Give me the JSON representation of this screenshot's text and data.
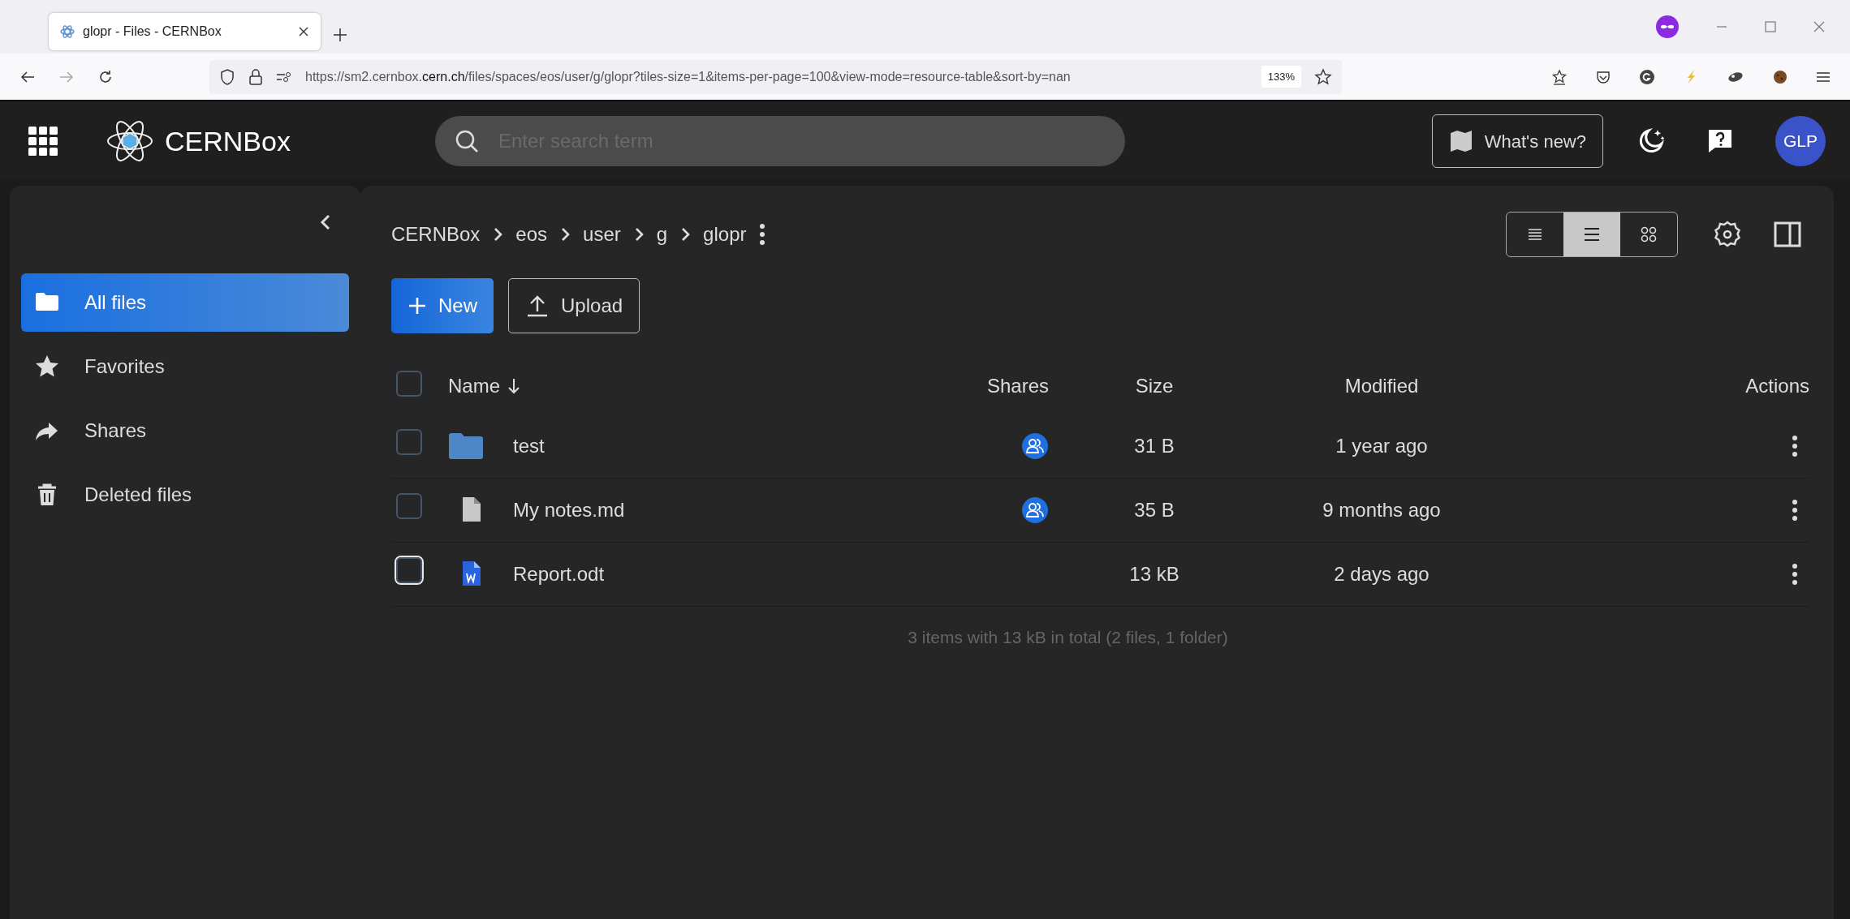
{
  "browser": {
    "tabs": [
      {
        "title": "glopr - Files - CERNBox",
        "selected": true
      }
    ],
    "url": "https://sm2.cernbox.**cern.ch**/files/spaces/eos/user/g/glopr?tiles-size=1&items-per-page=100&view-mode=resource-table&sort-by=nan",
    "zoom": "133%"
  },
  "header": {
    "logo": "CERNBox",
    "search": {
      "placeholder": "Enter search term"
    },
    "whats_new": "What's new?",
    "avatar": "GLP"
  },
  "sidebar": {
    "items": [
      {
        "label": "All files",
        "selected": true
      },
      {
        "label": "Favorites",
        "selected": false
      },
      {
        "label": "Shares",
        "selected": false
      },
      {
        "label": "Deleted files",
        "selected": false
      }
    ]
  },
  "breadcrumb": [
    "CERNBox",
    "eos",
    "user",
    "g",
    "glopr"
  ],
  "view_modes": [
    {
      "kind": "condensed",
      "selected": false
    },
    {
      "kind": "list",
      "selected": true
    },
    {
      "kind": "tiles",
      "selected": false
    }
  ],
  "buttons": {
    "new": "New",
    "upload": "Upload"
  },
  "table": {
    "select_all_checked": false,
    "columns": [
      "Name",
      "Shares",
      "Size",
      "Modified",
      "Actions"
    ],
    "rows": [
      {
        "kind": "folder",
        "name": "test",
        "shared": true,
        "size": "31 B",
        "modified": "1 year ago",
        "checked": false,
        "focused": false
      },
      {
        "kind": "file",
        "name": "My notes.md",
        "shared": true,
        "size": "35 B",
        "modified": "9 months ago",
        "checked": false,
        "focused": false
      },
      {
        "kind": "document",
        "name": "Report.odt",
        "shared": false,
        "size": "13 kB",
        "modified": "2 days ago",
        "checked": false,
        "focused": true
      }
    ],
    "footer": "3 items with 13 kB in total (2 files, 1 folder)"
  }
}
